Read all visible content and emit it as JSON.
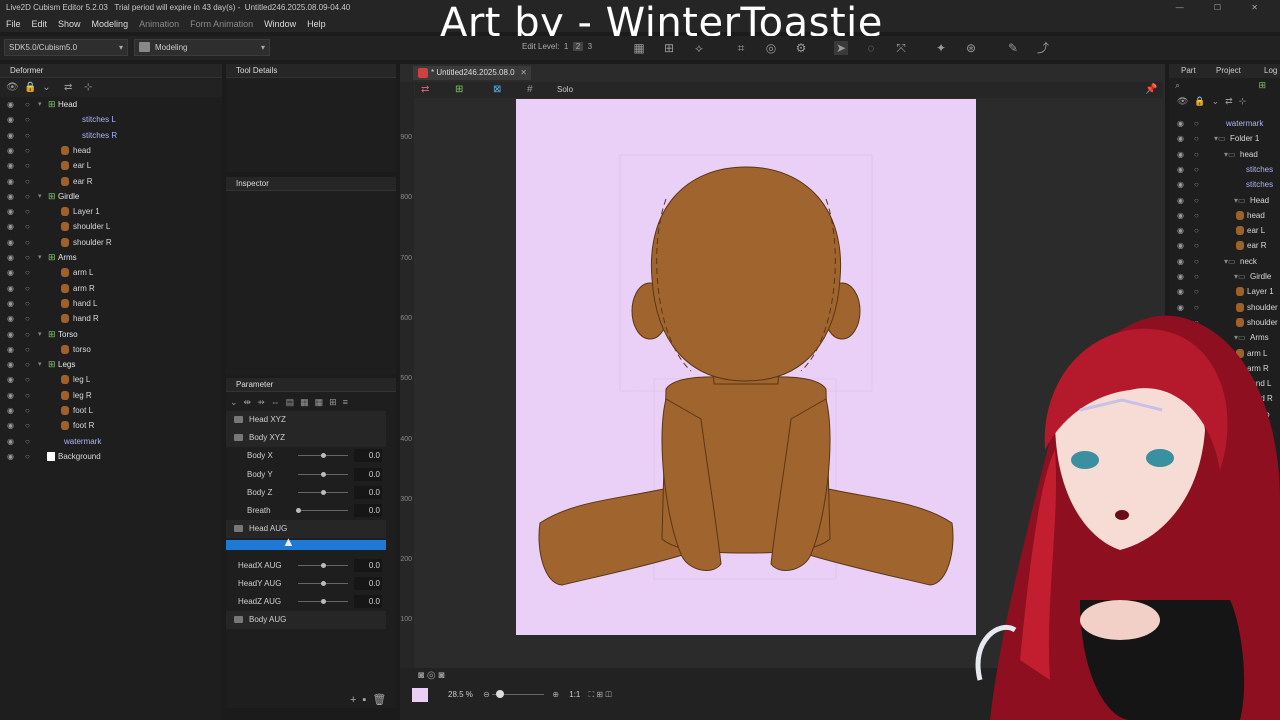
{
  "app": {
    "title": "Live2D Cubism Editor 5.2.03",
    "trial": "Trial period will expire in 43 day(s)",
    "file": "Untitled246.2025.08.09-04.40"
  },
  "overlay": {
    "text": "Art by - WinterToastie"
  },
  "menu": [
    {
      "label": "File",
      "dim": false
    },
    {
      "label": "Edit",
      "dim": false
    },
    {
      "label": "Show",
      "dim": false
    },
    {
      "label": "Modeling",
      "dim": false
    },
    {
      "label": "Animation",
      "dim": true
    },
    {
      "label": "Form Animation",
      "dim": true
    },
    {
      "label": "Window",
      "dim": false
    },
    {
      "label": "Help",
      "dim": false
    }
  ],
  "toolbar": {
    "sdk": "SDK5.0/Cubism5.0",
    "mode": "Modeling",
    "edit_level_label": "Edit Level:",
    "edit_levels": [
      "1",
      "2",
      "3"
    ]
  },
  "deformer": {
    "title": "Deformer",
    "items": [
      {
        "label": "Head",
        "kind": "folder",
        "depth": 0
      },
      {
        "label": "stitches L",
        "kind": "mesh",
        "depth": 2
      },
      {
        "label": "stitches R",
        "kind": "mesh",
        "depth": 2
      },
      {
        "label": "head",
        "kind": "art",
        "depth": 1
      },
      {
        "label": "ear L",
        "kind": "art",
        "depth": 1
      },
      {
        "label": "ear R",
        "kind": "art",
        "depth": 1
      },
      {
        "label": "Girdle",
        "kind": "folder",
        "depth": 0
      },
      {
        "label": "Layer 1",
        "kind": "art",
        "depth": 1
      },
      {
        "label": "shoulder L",
        "kind": "art",
        "depth": 1
      },
      {
        "label": "shoulder R",
        "kind": "art",
        "depth": 1
      },
      {
        "label": "Arms",
        "kind": "folder",
        "depth": 0
      },
      {
        "label": "arm L",
        "kind": "art",
        "depth": 1
      },
      {
        "label": "arm R",
        "kind": "art",
        "depth": 1
      },
      {
        "label": "hand L",
        "kind": "art",
        "depth": 1
      },
      {
        "label": "hand R",
        "kind": "art",
        "depth": 1
      },
      {
        "label": "Torso",
        "kind": "folder",
        "depth": 0
      },
      {
        "label": "torso",
        "kind": "art",
        "depth": 1
      },
      {
        "label": "Legs",
        "kind": "folder",
        "depth": 0
      },
      {
        "label": "leg L",
        "kind": "art",
        "depth": 1
      },
      {
        "label": "leg R",
        "kind": "art",
        "depth": 1
      },
      {
        "label": "foot L",
        "kind": "art",
        "depth": 1
      },
      {
        "label": "foot R",
        "kind": "art",
        "depth": 1
      },
      {
        "label": "watermark",
        "kind": "mesh",
        "depth": 0
      },
      {
        "label": "Background",
        "kind": "bg",
        "depth": 0
      }
    ]
  },
  "panels": {
    "tool_details": "Tool Details",
    "inspector": "Inspector",
    "parameter": "Parameter"
  },
  "parameters": [
    {
      "label": "Head XYZ",
      "type": "group"
    },
    {
      "label": "Body XYZ",
      "type": "group"
    },
    {
      "label": "Body X",
      "type": "param",
      "value": "0.0",
      "level": 0.5
    },
    {
      "label": "Body Y",
      "type": "param",
      "value": "0.0",
      "level": 0.5
    },
    {
      "label": "Body Z",
      "type": "param",
      "value": "0.0",
      "level": 0.5
    },
    {
      "label": "Breath",
      "type": "param",
      "value": "0.0",
      "level": 0.0
    },
    {
      "label": "Head AUG",
      "type": "group"
    },
    {
      "label": "",
      "type": "selected"
    },
    {
      "label": "HeadX AUG",
      "type": "param",
      "value": "0.0",
      "level": 0.5
    },
    {
      "label": "HeadY AUG",
      "type": "param",
      "value": "0.0",
      "level": 0.5
    },
    {
      "label": "HeadZ AUG",
      "type": "param",
      "value": "0.0",
      "level": 0.5
    },
    {
      "label": "Body AUG",
      "type": "group"
    }
  ],
  "canvas": {
    "tab": "* Untitled246.2025.08.0",
    "solo": "Solo",
    "zoom": "28.5 %",
    "ratio": "1:1",
    "ruler": [
      "900",
      "800",
      "700",
      "600",
      "500",
      "400",
      "300",
      "200",
      "100"
    ],
    "bg_color": "#ead0f7",
    "skin": "#a0652f"
  },
  "right": {
    "tabs": [
      "Part",
      "Project",
      "Log"
    ],
    "items": [
      {
        "label": "watermark",
        "kind": "mesh",
        "indent": 0
      },
      {
        "label": "Folder 1",
        "kind": "folder",
        "indent": 0
      },
      {
        "label": "head",
        "kind": "folder",
        "indent": 1
      },
      {
        "label": "stitches",
        "kind": "mesh",
        "indent": 2
      },
      {
        "label": "stitches",
        "kind": "mesh",
        "indent": 2
      },
      {
        "label": "Head",
        "kind": "folder",
        "indent": 2
      },
      {
        "label": "head",
        "kind": "art",
        "indent": 2
      },
      {
        "label": "ear L",
        "kind": "art",
        "indent": 2
      },
      {
        "label": "ear R",
        "kind": "art",
        "indent": 2
      },
      {
        "label": "neck",
        "kind": "folder",
        "indent": 1
      },
      {
        "label": "Girdle",
        "kind": "folder",
        "indent": 2
      },
      {
        "label": "Layer 1",
        "kind": "art",
        "indent": 2
      },
      {
        "label": "shoulder L",
        "kind": "art",
        "indent": 2
      },
      {
        "label": "shoulder R",
        "kind": "art",
        "indent": 2
      },
      {
        "label": "Arms",
        "kind": "folder",
        "indent": 2
      },
      {
        "label": "arm L",
        "kind": "art",
        "indent": 2
      },
      {
        "label": "arm R",
        "kind": "art",
        "indent": 2
      },
      {
        "label": "hand L",
        "kind": "art",
        "indent": 2
      },
      {
        "label": "hand R",
        "kind": "art",
        "indent": 2
      },
      {
        "label": "Torso",
        "kind": "folder",
        "indent": 2
      },
      {
        "label": "torso",
        "kind": "art",
        "indent": 2
      },
      {
        "label": "Legs",
        "kind": "folder",
        "indent": 2
      },
      {
        "label": "leg L",
        "kind": "art",
        "indent": 2
      },
      {
        "label": "leg R",
        "kind": "art",
        "indent": 2
      },
      {
        "label": "foot L",
        "kind": "art",
        "indent": 2
      },
      {
        "label": "round",
        "kind": "art",
        "indent": 2
      }
    ]
  }
}
